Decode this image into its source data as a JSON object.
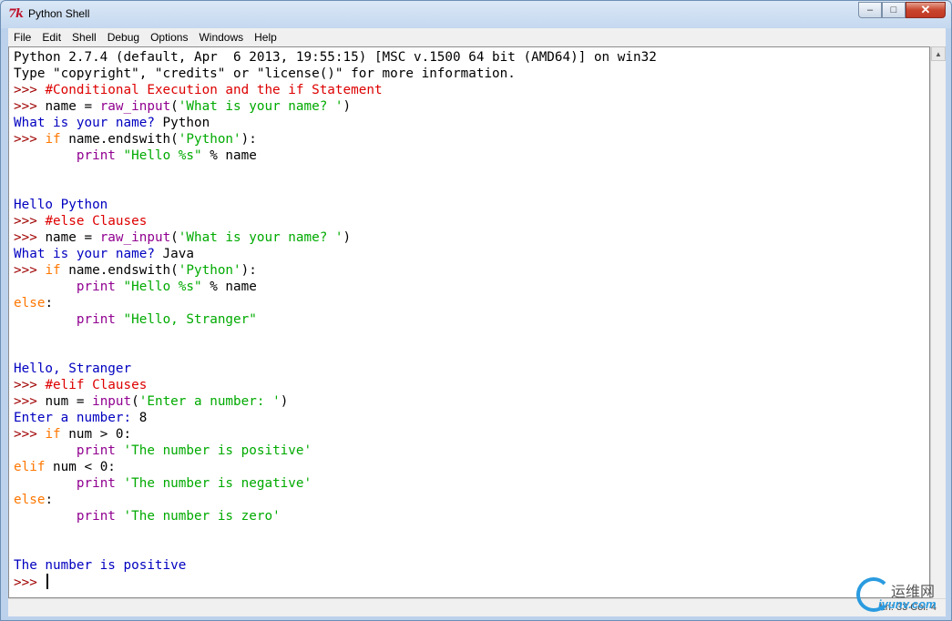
{
  "window": {
    "title": "Python Shell",
    "app_icon": "7k"
  },
  "controls": {
    "minimize": "–",
    "maximize": "□",
    "close": "✕"
  },
  "menu": [
    {
      "label": "File"
    },
    {
      "label": "Edit"
    },
    {
      "label": "Shell"
    },
    {
      "label": "Debug"
    },
    {
      "label": "Options"
    },
    {
      "label": "Windows"
    },
    {
      "label": "Help"
    }
  ],
  "shell_lines": [
    [
      {
        "t": "Python 2.7.4 (default, Apr  6 2013, 19:55:15) [MSC v.1500 64 bit (AMD64)] on win32",
        "c": "plain"
      }
    ],
    [
      {
        "t": "Type \"copyright\", \"credits\" or \"license()\" for more information.",
        "c": "plain"
      }
    ],
    [
      {
        "t": ">>> ",
        "c": "prompt"
      },
      {
        "t": "#Conditional Execution and the if Statement",
        "c": "comment"
      }
    ],
    [
      {
        "t": ">>> ",
        "c": "prompt"
      },
      {
        "t": "name = ",
        "c": "plain"
      },
      {
        "t": "raw_input",
        "c": "builtin"
      },
      {
        "t": "(",
        "c": "plain"
      },
      {
        "t": "'What is your name? '",
        "c": "str"
      },
      {
        "t": ")",
        "c": "plain"
      }
    ],
    [
      {
        "t": "What is your name? ",
        "c": "out"
      },
      {
        "t": "Python",
        "c": "plain"
      }
    ],
    [
      {
        "t": ">>> ",
        "c": "prompt"
      },
      {
        "t": "if",
        "c": "kw"
      },
      {
        "t": " name.endswith(",
        "c": "plain"
      },
      {
        "t": "'Python'",
        "c": "str"
      },
      {
        "t": "):",
        "c": "plain"
      }
    ],
    [
      {
        "t": "        ",
        "c": "plain"
      },
      {
        "t": "print",
        "c": "builtin"
      },
      {
        "t": " ",
        "c": "plain"
      },
      {
        "t": "\"Hello %s\"",
        "c": "str"
      },
      {
        "t": " % name",
        "c": "plain"
      }
    ],
    [],
    [],
    [
      {
        "t": "Hello Python",
        "c": "out"
      }
    ],
    [
      {
        "t": ">>> ",
        "c": "prompt"
      },
      {
        "t": "#else Clauses",
        "c": "comment"
      }
    ],
    [
      {
        "t": ">>> ",
        "c": "prompt"
      },
      {
        "t": "name = ",
        "c": "plain"
      },
      {
        "t": "raw_input",
        "c": "builtin"
      },
      {
        "t": "(",
        "c": "plain"
      },
      {
        "t": "'What is your name? '",
        "c": "str"
      },
      {
        "t": ")",
        "c": "plain"
      }
    ],
    [
      {
        "t": "What is your name? ",
        "c": "out"
      },
      {
        "t": "Java",
        "c": "plain"
      }
    ],
    [
      {
        "t": ">>> ",
        "c": "prompt"
      },
      {
        "t": "if",
        "c": "kw"
      },
      {
        "t": " name.endswith(",
        "c": "plain"
      },
      {
        "t": "'Python'",
        "c": "str"
      },
      {
        "t": "):",
        "c": "plain"
      }
    ],
    [
      {
        "t": "        ",
        "c": "plain"
      },
      {
        "t": "print",
        "c": "builtin"
      },
      {
        "t": " ",
        "c": "plain"
      },
      {
        "t": "\"Hello %s\"",
        "c": "str"
      },
      {
        "t": " % name",
        "c": "plain"
      }
    ],
    [
      {
        "t": "else",
        "c": "kw"
      },
      {
        "t": ":",
        "c": "plain"
      }
    ],
    [
      {
        "t": "        ",
        "c": "plain"
      },
      {
        "t": "print",
        "c": "builtin"
      },
      {
        "t": " ",
        "c": "plain"
      },
      {
        "t": "\"Hello, Stranger\"",
        "c": "str"
      }
    ],
    [],
    [],
    [
      {
        "t": "Hello, Stranger",
        "c": "out"
      }
    ],
    [
      {
        "t": ">>> ",
        "c": "prompt"
      },
      {
        "t": "#elif Clauses",
        "c": "comment"
      }
    ],
    [
      {
        "t": ">>> ",
        "c": "prompt"
      },
      {
        "t": "num = ",
        "c": "plain"
      },
      {
        "t": "input",
        "c": "builtin"
      },
      {
        "t": "(",
        "c": "plain"
      },
      {
        "t": "'Enter a number: '",
        "c": "str"
      },
      {
        "t": ")",
        "c": "plain"
      }
    ],
    [
      {
        "t": "Enter a number: ",
        "c": "out"
      },
      {
        "t": "8",
        "c": "plain"
      }
    ],
    [
      {
        "t": ">>> ",
        "c": "prompt"
      },
      {
        "t": "if",
        "c": "kw"
      },
      {
        "t": " num > 0:",
        "c": "plain"
      }
    ],
    [
      {
        "t": "        ",
        "c": "plain"
      },
      {
        "t": "print",
        "c": "builtin"
      },
      {
        "t": " ",
        "c": "plain"
      },
      {
        "t": "'The number is positive'",
        "c": "str"
      }
    ],
    [
      {
        "t": "elif",
        "c": "kw"
      },
      {
        "t": " num < 0:",
        "c": "plain"
      }
    ],
    [
      {
        "t": "        ",
        "c": "plain"
      },
      {
        "t": "print",
        "c": "builtin"
      },
      {
        "t": " ",
        "c": "plain"
      },
      {
        "t": "'The number is negative'",
        "c": "str"
      }
    ],
    [
      {
        "t": "else",
        "c": "kw"
      },
      {
        "t": ":",
        "c": "plain"
      }
    ],
    [
      {
        "t": "        ",
        "c": "plain"
      },
      {
        "t": "print",
        "c": "builtin"
      },
      {
        "t": " ",
        "c": "plain"
      },
      {
        "t": "'The number is zero'",
        "c": "str"
      }
    ],
    [],
    [],
    [
      {
        "t": "The number is positive",
        "c": "out"
      }
    ],
    [
      {
        "t": ">>> ",
        "c": "prompt"
      }
    ]
  ],
  "status": {
    "position": "Ln: 33 Col: 4"
  },
  "watermark": {
    "text": "运维网",
    "sub": "iyunv.com"
  },
  "colors": {
    "prompt": "#a00000",
    "comment": "#dd0000",
    "keyword": "#ff7700",
    "builtin": "#900090",
    "string": "#00aa00",
    "output": "#0000c0"
  }
}
